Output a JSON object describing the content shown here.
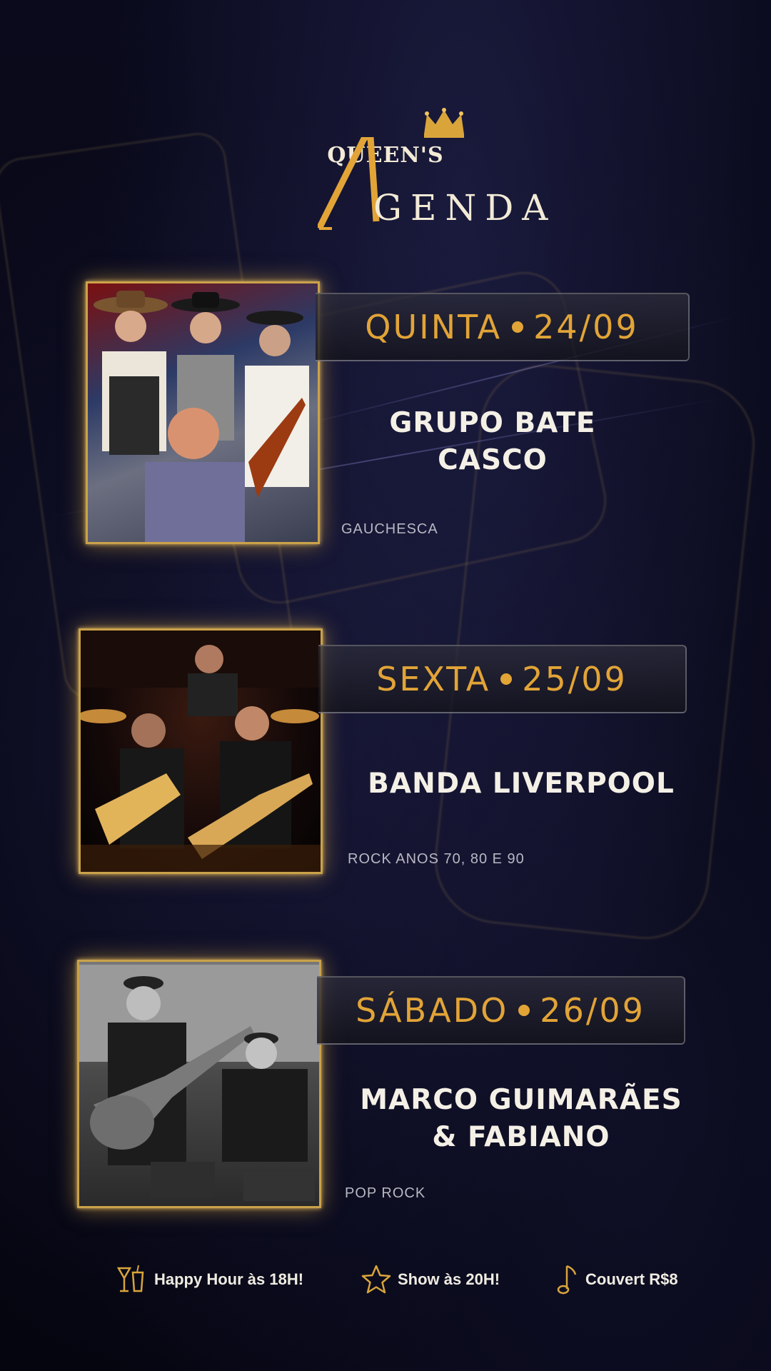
{
  "header": {
    "brand": "QUEEN'S",
    "title_rest": "GENDA",
    "crown_icon": "crown-icon"
  },
  "events": [
    {
      "day": "QUINTA",
      "date": "24/09",
      "band_line1": "GRUPO BATE",
      "band_line2": "CASCO",
      "genre": "GAUCHESCA"
    },
    {
      "day": "SEXTA",
      "date": "25/09",
      "band_line1": "BANDA LIVERPOOL",
      "genre": "ROCK ANOS 70, 80 E 90"
    },
    {
      "day": "SÁBADO",
      "date": "26/09",
      "band_line1": "MARCO GUIMARÃES",
      "band_line2": "& FABIANO",
      "genre": "POP ROCK"
    }
  ],
  "footer": {
    "happy_hour": "Happy Hour às 18H!",
    "show": "Show às 20H!",
    "couvert": "Couvert R$8"
  },
  "colors": {
    "accent": "#e2a437",
    "background": "#050510",
    "text": "#f4f0e6"
  }
}
